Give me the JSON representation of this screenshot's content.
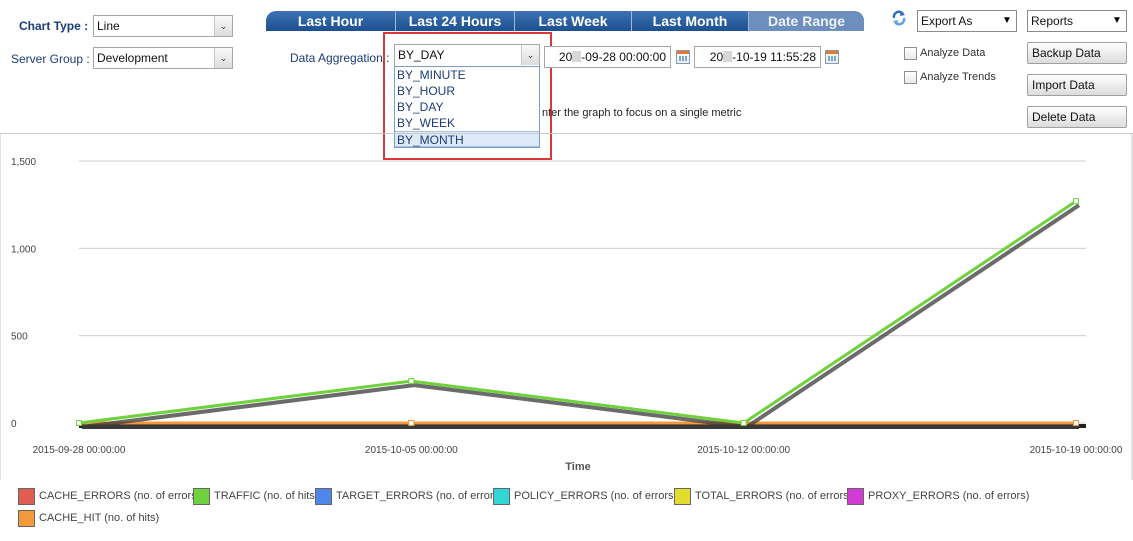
{
  "controls": {
    "chart_type_label": "Chart Type :",
    "chart_type_value": "Line",
    "server_group_label": "Server Group :",
    "server_group_value": "Development",
    "data_aggregation_label": "Data Aggregation :",
    "data_aggregation_value": "BY_DAY",
    "aggregation_options": [
      "BY_MINUTE",
      "BY_HOUR",
      "BY_DAY",
      "BY_WEEK",
      "BY_MONTH"
    ],
    "aggregation_highlighted": "BY_MONTH",
    "start_date_prefix": "20",
    "start_date_suffix": "-09-28 00:00:00",
    "end_date_prefix": "20",
    "end_date_suffix": "-10-19 11:55:28",
    "hint_text": "nter the graph to focus on a single metric"
  },
  "tabs": [
    "Last Hour",
    "Last 24 Hours",
    "Last Week",
    "Last Month",
    "Date Range"
  ],
  "active_tab": "Date Range",
  "right_panel": {
    "export_label": "Export As",
    "reports_label": "Reports",
    "analyze_data_label": "Analyze Data",
    "analyze_trends_label": "Analyze Trends",
    "backup_label": "Backup Data",
    "import_label": "Import Data",
    "delete_label": "Delete Data"
  },
  "icons": {
    "refresh": "refresh-icon",
    "calendar": "calendar-icon",
    "dropdown": "chevron-down-icon"
  },
  "chart_data": {
    "type": "line",
    "xlabel": "Time",
    "ylabel": "",
    "x": [
      "2015-09-28 00:00:00",
      "2015-10-05 00:00:00",
      "2015-10-12 00:00:00",
      "2015-10-19 00:00:00"
    ],
    "ylim": [
      0,
      1500
    ],
    "yticks": [
      0,
      500,
      1000,
      1500
    ],
    "ytick_labels": [
      "0",
      "500",
      "1,000",
      "1,500"
    ],
    "grid": true,
    "legend_position": "bottom",
    "series": [
      {
        "name": "CACHE_ERRORS (no. of errors)",
        "color": "#e05d4f",
        "values": [
          0,
          0,
          0,
          0
        ]
      },
      {
        "name": "TRAFFIC (no. of hits)",
        "color": "#6fd13c",
        "values": [
          0,
          240,
          0,
          1270
        ]
      },
      {
        "name": "TARGET_ERRORS (no. of errors)",
        "color": "#4f86ea",
        "values": [
          0,
          0,
          0,
          0
        ]
      },
      {
        "name": "POLICY_ERRORS (no. of errors)",
        "color": "#33d6d6",
        "values": [
          0,
          0,
          0,
          0
        ]
      },
      {
        "name": "TOTAL_ERRORS (no. of errors)",
        "color": "#e2dc2e",
        "values": [
          0,
          0,
          0,
          0
        ]
      },
      {
        "name": "PROXY_ERRORS (no. of errors)",
        "color": "#d43ad4",
        "values": [
          0,
          0,
          0,
          0
        ]
      },
      {
        "name": "CACHE_HIT (no. of hits)",
        "color": "#f39a3d",
        "values": [
          0,
          0,
          0,
          0
        ]
      }
    ]
  }
}
